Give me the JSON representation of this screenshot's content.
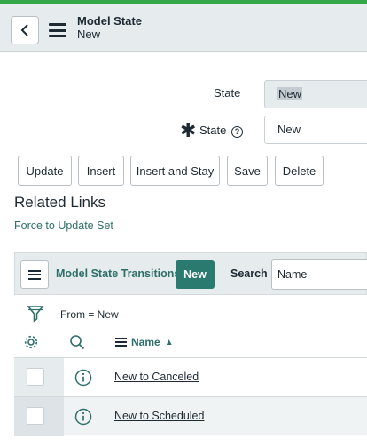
{
  "header": {
    "title": "Model State",
    "subtitle": "New"
  },
  "form": {
    "readonly_state_label": "State",
    "readonly_state_value": "New",
    "state_label": "State",
    "state_value": "New"
  },
  "buttons": {
    "update": "Update",
    "insert": "Insert",
    "insert_and_stay": "Insert and Stay",
    "save": "Save",
    "delete": "Delete"
  },
  "related_links": {
    "title": "Related Links",
    "force_update_set": "Force to Update Set"
  },
  "related_list": {
    "title": "Model State Transitions",
    "new_label": "New",
    "search_label": "Search",
    "search_field": "Name",
    "filter": "From = New",
    "column_name": "Name",
    "rows": [
      {
        "name": "New to Canceled"
      },
      {
        "name": "New to Scheduled"
      }
    ]
  },
  "colors": {
    "accent_green": "#35a84a",
    "teal": "#2b7a70",
    "link": "#2e6f6a"
  }
}
